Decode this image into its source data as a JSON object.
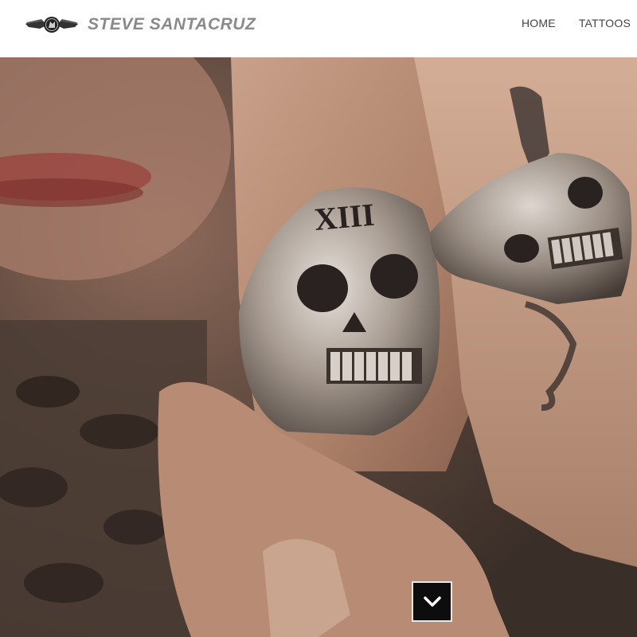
{
  "header": {
    "brand": "STEVE SANTACRUZ",
    "logo_icon": "winged-crest-icon",
    "nav": [
      {
        "label": "HOME"
      },
      {
        "label": "TATTOOS"
      }
    ]
  },
  "hero": {
    "image": "photo of tattooed hand wearing silver skull rings",
    "ring_engraving": "XIII"
  },
  "scroll_button": {
    "icon": "chevron-down-icon"
  },
  "colors": {
    "brand_text": "#8a8a8a",
    "nav_text": "#444444",
    "button_bg": "#0d0d0d",
    "button_icon": "#ffffff"
  }
}
